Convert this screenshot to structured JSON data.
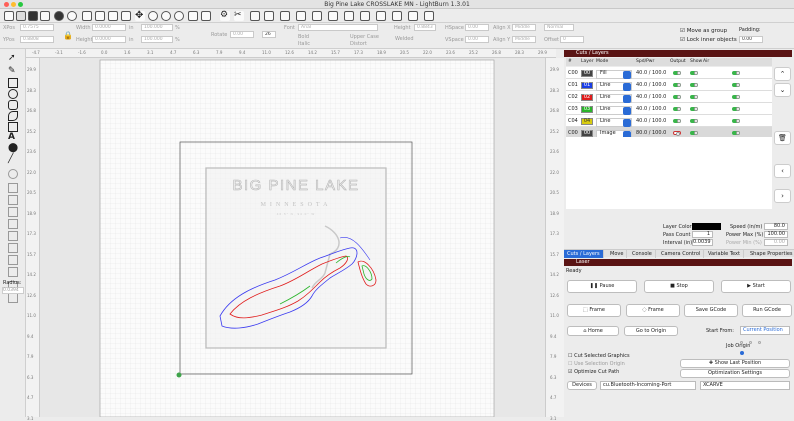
{
  "window": {
    "title": "Big Pine Lake CROSSLAKE MN - LightBurn 1.3.01"
  },
  "props": {
    "xpos_label": "XPos",
    "xpos_value": "0.7575",
    "ypos_label": "YPos",
    "ypos_value": "0.8808",
    "width_label": "Width",
    "width_value": "0.0000",
    "height_label": "Height",
    "height_value": "0.0000",
    "unit_in": "in",
    "w_pct": "100.000",
    "h_pct": "100.000",
    "pct": "%",
    "rotate_label": "Rotate",
    "rotate_value": "0.00",
    "dpi": "26",
    "font_label": "Font",
    "font_value": "Arial",
    "height2_label": "Height",
    "height2_value": "0.8843",
    "bold": "Bold",
    "italic": "Italic",
    "upper_case": "Upper Case",
    "distort": "Distort",
    "welded": "Welded",
    "hspace_label": "HSpace",
    "hspace_value": "0.00",
    "vspace_label": "VSpace",
    "vspace_value": "0.00",
    "alignx_label": "Align X",
    "alignx_value": "Middle",
    "aligny_label": "Align Y",
    "aligny_value": "Middle",
    "normal": "Normal",
    "offset_label": "Offset",
    "offset_value": "0",
    "move_as_group": "Move as group",
    "lock_inner": "Lock inner objects",
    "padding_label": "Padding:",
    "padding_value": "0.00"
  },
  "ruler_top": [
    "-4.7",
    "-3.1",
    "-1.6",
    "0.0",
    "1.6",
    "3.1",
    "4.7",
    "6.3",
    "7.9",
    "9.4",
    "11.0",
    "12.6",
    "14.2",
    "15.7",
    "17.3",
    "18.9",
    "20.5",
    "22.0",
    "23.6",
    "25.2",
    "26.8",
    "28.3",
    "29.9"
  ],
  "ruler_left": [
    "29.9",
    "28.3",
    "26.8",
    "25.2",
    "23.6",
    "22.0",
    "20.5",
    "18.9",
    "17.3",
    "15.7",
    "14.2",
    "12.6",
    "11.0",
    "9.4",
    "7.9",
    "6.3",
    "4.7",
    "3.1"
  ],
  "ruler_right": [
    "29.9",
    "28.3",
    "26.8",
    "25.2",
    "23.6",
    "22.0",
    "20.5",
    "18.9",
    "17.3",
    "15.7",
    "14.2",
    "12.6",
    "11.0",
    "9.4",
    "7.9",
    "6.3",
    "4.7",
    "3.1"
  ],
  "art": {
    "title": "BIG PINE LAKE",
    "subtitle": "MINNESOTA",
    "coords": "46.5° N, 94.0° W"
  },
  "radius": {
    "label": "Radius:",
    "value": "0.0394"
  },
  "cuts": {
    "header": "Cuts / Layers",
    "cols": {
      "num": "#",
      "layer": "Layer",
      "mode": "Mode",
      "spd": "Spd/Pwr",
      "output": "Output",
      "show": "Show",
      "air": "Air"
    },
    "rows": [
      {
        "num": "C00",
        "layer": "00",
        "mode": "Fill",
        "spd": "40.0 / 100.0",
        "color": "#444444"
      },
      {
        "num": "C01",
        "layer": "01",
        "mode": "Line",
        "spd": "40.0 / 100.0",
        "color": "#1a3ee6"
      },
      {
        "num": "C02",
        "layer": "02",
        "mode": "Line",
        "spd": "40.0 / 100.0",
        "color": "#e01c1c"
      },
      {
        "num": "C03",
        "layer": "03",
        "mode": "Line",
        "spd": "40.0 / 100.0",
        "color": "#2bb52b"
      },
      {
        "num": "C04",
        "layer": "04",
        "mode": "Line",
        "spd": "40.0 / 100.0",
        "color": "#d8cc10"
      },
      {
        "num": "C00",
        "layer": "00",
        "mode": "Image",
        "spd": "80.0 / 100.0",
        "color": "#444444"
      }
    ],
    "layer_color": "Layer Color",
    "speed_label": "Speed (in/m)",
    "speed": "80.0",
    "pass_label": "Pass Count",
    "pass": "1",
    "pmax_label": "Power Max (%)",
    "pmax": "100.00",
    "interval_label": "Interval (in)",
    "interval": "0.0039",
    "pmin_label": "Power Min (%)",
    "pmin": "0.00"
  },
  "tabs": [
    "Cuts / Layers",
    "Move",
    "Console",
    "Camera Control",
    "Variable Text",
    "Shape Properties"
  ],
  "laser": {
    "header": "Laser",
    "status": "Ready",
    "pause": "Pause",
    "stop": "Stop",
    "start": "Start",
    "frame1": "Frame",
    "frame2": "Frame",
    "save_gcode": "Save GCode",
    "run_gcode": "Run GCode",
    "home": "Home",
    "go_origin": "Go to Origin",
    "start_from": "Start From:",
    "start_from_value": "Current Position",
    "job_origin": "Job Origin",
    "cut_selected": "Cut Selected Graphics",
    "use_selection_origin": "Use Selection Origin",
    "optimize": "Optimize Cut Path",
    "show_last": "Show Last Position",
    "opt_settings": "Optimization Settings",
    "devices": "Devices",
    "port": "cu.Bluetooth-Incoming-Port",
    "device": "XCARVE"
  },
  "colors": {
    "accent": "#2a6bd6",
    "header": "#5a1414",
    "toggle": "#39b54a"
  }
}
